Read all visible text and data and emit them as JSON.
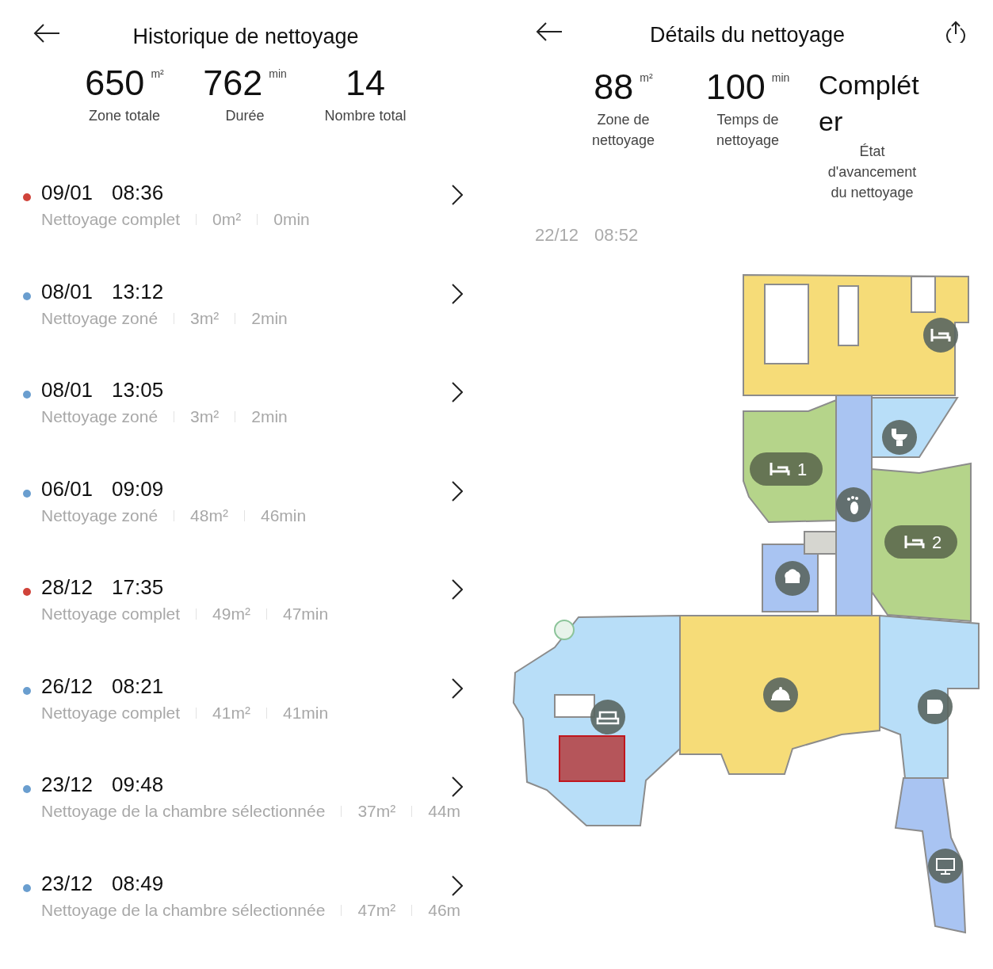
{
  "history": {
    "title": "Historique de nettoyage",
    "stats": [
      {
        "value": "650",
        "unit": "m²",
        "label": "Zone totale"
      },
      {
        "value": "762",
        "unit": "min",
        "label": "Durée"
      },
      {
        "value": "14",
        "label": "Nombre total"
      }
    ],
    "entries": [
      {
        "date": "09/01",
        "time": "08:36",
        "mode": "Nettoyage complet",
        "area": "0m²",
        "duration": "0min",
        "color": "#d0433a"
      },
      {
        "date": "08/01",
        "time": "13:12",
        "mode": "Nettoyage zoné",
        "area": "3m²",
        "duration": "2min",
        "color": "#6a9ecf"
      },
      {
        "date": "08/01",
        "time": "13:05",
        "mode": "Nettoyage zoné",
        "area": "3m²",
        "duration": "2min",
        "color": "#6a9ecf"
      },
      {
        "date": "06/01",
        "time": "09:09",
        "mode": "Nettoyage zoné",
        "area": "48m²",
        "duration": "46min",
        "color": "#6a9ecf"
      },
      {
        "date": "28/12",
        "time": "17:35",
        "mode": "Nettoyage complet",
        "area": "49m²",
        "duration": "47min",
        "color": "#d0433a"
      },
      {
        "date": "26/12",
        "time": "08:21",
        "mode": "Nettoyage complet",
        "area": "41m²",
        "duration": "41min",
        "color": "#6a9ecf"
      },
      {
        "date": "23/12",
        "time": "09:48",
        "mode": "Nettoyage de la chambre sélectionnée",
        "area": "37m²",
        "duration": "44m",
        "color": "#6a9ecf"
      },
      {
        "date": "23/12",
        "time": "08:49",
        "mode": "Nettoyage de la chambre sélectionnée",
        "area": "47m²",
        "duration": "46m",
        "color": "#6a9ecf"
      }
    ]
  },
  "details": {
    "title": "Détails du nettoyage",
    "stats": [
      {
        "value": "88",
        "unit": "m²",
        "label": "Zone de nettoyage"
      },
      {
        "value": "100",
        "unit": "min",
        "label": "Temps de nettoyage"
      },
      {
        "value": "Compléter",
        "label": "État d'avancement du nettoyage"
      }
    ],
    "date": "22/12",
    "time": "08:52",
    "map": {
      "room_labels": [
        {
          "text": "1"
        },
        {
          "text": "2"
        }
      ]
    }
  }
}
